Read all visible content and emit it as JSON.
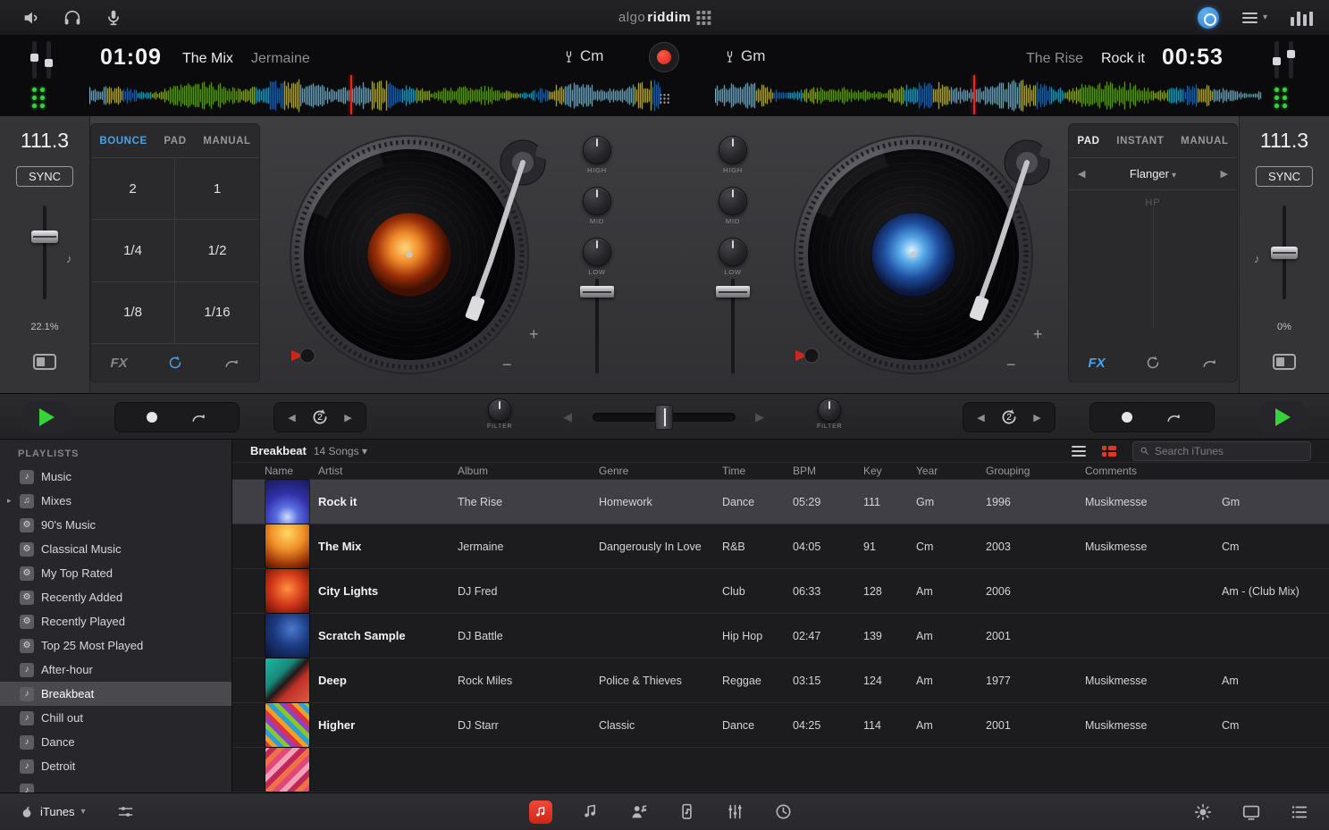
{
  "topbar": {
    "logo_light": "algo",
    "logo_bold": "riddim"
  },
  "header": {
    "left": {
      "time": "01:09",
      "title": "The Mix",
      "artist": "Jermaine",
      "key": "Cm"
    },
    "right": {
      "artist": "The Rise",
      "title": "Rock it",
      "time": "00:53",
      "key": "Gm"
    }
  },
  "waveforms": {
    "palette": [
      "#7ec832",
      "#b8e04a",
      "#3fc9f0",
      "#2f7fd0",
      "#e8e06a",
      "#9fd8f0"
    ],
    "left_progress": 0.456,
    "right_progress": 0.472,
    "playhead_color": "#e8281e"
  },
  "deck_left": {
    "bpm": "111.3",
    "sync_label": "SYNC",
    "pitch_pct": "22.1%",
    "tabs": [
      "BOUNCE",
      "PAD",
      "MANUAL"
    ],
    "active_tab": "BOUNCE",
    "pads": [
      "2",
      "1",
      "1/4",
      "1/2",
      "1/8",
      "1/16"
    ],
    "fx_label": "FX"
  },
  "deck_right": {
    "bpm": "111.3",
    "sync_label": "SYNC",
    "pitch_pct": "0%",
    "tabs": [
      "PAD",
      "INSTANT",
      "MANUAL"
    ],
    "active_tab": "PAD",
    "effect": "Flanger",
    "hp_label": "HP",
    "fx_label": "FX"
  },
  "mixer": {
    "eq": [
      "HIGH",
      "MID",
      "LOW"
    ],
    "filter_label": "FILTER",
    "loop_left": "2",
    "loop_right": "2"
  },
  "library": {
    "sidebar_header": "PLAYLISTS",
    "playlists": [
      {
        "label": "Music",
        "icon": "playlist"
      },
      {
        "label": "Mixes",
        "icon": "folder",
        "expandable": true
      },
      {
        "label": "90's Music",
        "icon": "smart"
      },
      {
        "label": "Classical Music",
        "icon": "smart"
      },
      {
        "label": "My Top Rated",
        "icon": "smart"
      },
      {
        "label": "Recently Added",
        "icon": "smart"
      },
      {
        "label": "Recently Played",
        "icon": "smart"
      },
      {
        "label": "Top 25 Most Played",
        "icon": "smart"
      },
      {
        "label": "After-hour",
        "icon": "playlist"
      },
      {
        "label": "Breakbeat",
        "icon": "playlist",
        "selected": true
      },
      {
        "label": "Chill out",
        "icon": "playlist"
      },
      {
        "label": "Dance",
        "icon": "playlist"
      },
      {
        "label": "Detroit",
        "icon": "playlist"
      }
    ],
    "toolbar": {
      "title": "Breakbeat",
      "count": "14 Songs",
      "search_placeholder": "Search iTunes"
    },
    "columns": [
      "Name",
      "Artist",
      "Album",
      "Genre",
      "Time",
      "BPM",
      "Key",
      "Year",
      "Grouping",
      "Comments"
    ],
    "rows": [
      {
        "name": "Rock it",
        "artist": "The Rise",
        "album": "Homework",
        "genre": "Dance",
        "time": "05:29",
        "bpm": "111",
        "key": "Gm",
        "year": "1996",
        "grouping": "Musikmesse",
        "comments": "Gm"
      },
      {
        "name": "The Mix",
        "artist": "Jermaine",
        "album": "Dangerously In Love",
        "genre": "R&B",
        "time": "04:05",
        "bpm": "91",
        "key": "Cm",
        "year": "2003",
        "grouping": "Musikmesse",
        "comments": "Cm"
      },
      {
        "name": "City Lights",
        "artist": "DJ Fred",
        "album": "",
        "genre": "Club",
        "time": "06:33",
        "bpm": "128",
        "key": "Am",
        "year": "2006",
        "grouping": "",
        "comments": "Am - (Club Mix)"
      },
      {
        "name": "Scratch Sample",
        "artist": "DJ Battle",
        "album": "",
        "genre": "Hip Hop",
        "time": "02:47",
        "bpm": "139",
        "key": "Am",
        "year": "2001",
        "grouping": "",
        "comments": ""
      },
      {
        "name": "Deep",
        "artist": "Rock Miles",
        "album": "Police & Thieves",
        "genre": "Reggae",
        "time": "03:15",
        "bpm": "124",
        "key": "Am",
        "year": "1977",
        "grouping": "Musikmesse",
        "comments": "Am"
      },
      {
        "name": "Higher",
        "artist": "DJ Starr",
        "album": "Classic",
        "genre": "Dance",
        "time": "04:25",
        "bpm": "114",
        "key": "Am",
        "year": "2001",
        "grouping": "Musikmesse",
        "comments": "Cm"
      }
    ]
  },
  "bottombar": {
    "source": "iTunes"
  },
  "colors": {
    "accent_blue": "#4aa3e8",
    "play_green": "#35d43a",
    "record_red": "#e0342b"
  }
}
